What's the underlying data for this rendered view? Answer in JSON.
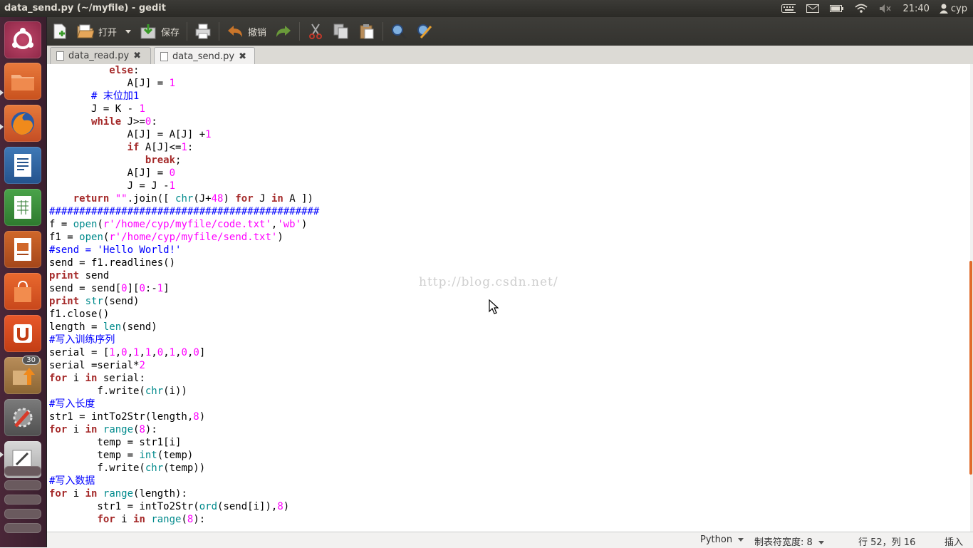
{
  "window": {
    "title": "data_send.py (~/myfile) - gedit"
  },
  "indicators": {
    "time": "21:40",
    "user": "cyp"
  },
  "launcher": {
    "badge_count": "30"
  },
  "toolbar": {
    "open_label": "打开",
    "save_label": "保存",
    "undo_label": "撤销"
  },
  "tabs": [
    {
      "label": "data_read.py"
    },
    {
      "label": "data_send.py"
    }
  ],
  "watermark": "http://blog.csdn.net/",
  "code_lines": [
    [
      [
        "          ",
        ""
      ],
      [
        "else",
        ":kw"
      ],
      [
        ":",
        ""
      ]
    ],
    [
      [
        "             A[J] = ",
        ""
      ],
      [
        "1",
        "num"
      ]
    ],
    [
      [
        "       ",
        ""
      ],
      [
        "# 末位加1",
        "cm"
      ]
    ],
    [
      [
        "       J = K - ",
        ""
      ],
      [
        "1",
        "num"
      ]
    ],
    [
      [
        "       ",
        ""
      ],
      [
        "while",
        "kw"
      ],
      [
        " J>=",
        ""
      ],
      [
        "0",
        "num"
      ],
      [
        ":",
        ""
      ]
    ],
    [
      [
        "             A[J] = A[J] +",
        ""
      ],
      [
        "1",
        "num"
      ]
    ],
    [
      [
        "             ",
        ""
      ],
      [
        "if",
        "kw"
      ],
      [
        " A[J]<=",
        ""
      ],
      [
        "1",
        "num"
      ],
      [
        ":",
        ""
      ]
    ],
    [
      [
        "                ",
        ""
      ],
      [
        "break",
        "kw"
      ],
      [
        ";",
        ""
      ]
    ],
    [
      [
        "             A[J] = ",
        ""
      ],
      [
        "0",
        "num"
      ]
    ],
    [
      [
        "             J = J -",
        ""
      ],
      [
        "1",
        "num"
      ]
    ],
    [
      [
        "    ",
        ""
      ],
      [
        "return",
        "kw"
      ],
      [
        " ",
        ""
      ],
      [
        "\"\"",
        "str"
      ],
      [
        ".join([ ",
        ""
      ],
      [
        "chr",
        "bi"
      ],
      [
        "(J+",
        ""
      ],
      [
        "48",
        "num"
      ],
      [
        ") ",
        ""
      ],
      [
        "for",
        "kw"
      ],
      [
        " J ",
        ""
      ],
      [
        "in",
        "kw"
      ],
      [
        " A ])",
        ""
      ]
    ],
    [
      [
        "#############################################",
        "cm"
      ]
    ],
    [
      [
        "f = ",
        ""
      ],
      [
        "open",
        "bi"
      ],
      [
        "(",
        ""
      ],
      [
        "r'/home/cyp/myfile/code.txt'",
        "str"
      ],
      [
        ",",
        ""
      ],
      [
        "'wb'",
        "str"
      ],
      [
        ")",
        ""
      ]
    ],
    [
      [
        "f1 = ",
        ""
      ],
      [
        "open",
        "bi"
      ],
      [
        "(",
        ""
      ],
      [
        "r'/home/cyp/myfile/send.txt'",
        "str"
      ],
      [
        ")",
        ""
      ]
    ],
    [
      [
        "#send = 'Hello World!'",
        "cm"
      ]
    ],
    [
      [
        "send = f1.readlines()",
        ""
      ]
    ],
    [
      [
        "print",
        "kw"
      ],
      [
        " send",
        ""
      ]
    ],
    [
      [
        "send = send[",
        ""
      ],
      [
        "0",
        "num"
      ],
      [
        "][",
        ""
      ],
      [
        "0",
        "num"
      ],
      [
        ":-",
        ""
      ],
      [
        "1",
        "num"
      ],
      [
        "]",
        ""
      ]
    ],
    [
      [
        "print",
        "kw"
      ],
      [
        " ",
        ""
      ],
      [
        "str",
        "bi"
      ],
      [
        "(send)",
        ""
      ]
    ],
    [
      [
        "f1.close()",
        ""
      ]
    ],
    [
      [
        "length = ",
        ""
      ],
      [
        "len",
        "bi"
      ],
      [
        "(send)",
        ""
      ]
    ],
    [
      [
        "#写入训练序列",
        "cm"
      ]
    ],
    [
      [
        "serial = [",
        ""
      ],
      [
        "1",
        "num"
      ],
      [
        ",",
        ""
      ],
      [
        "0",
        "num"
      ],
      [
        ",",
        ""
      ],
      [
        "1",
        "num"
      ],
      [
        ",",
        ""
      ],
      [
        "1",
        "num"
      ],
      [
        ",",
        ""
      ],
      [
        "0",
        "num"
      ],
      [
        ",",
        ""
      ],
      [
        "1",
        "num"
      ],
      [
        ",",
        ""
      ],
      [
        "0",
        "num"
      ],
      [
        ",",
        ""
      ],
      [
        "0",
        "num"
      ],
      [
        "]",
        ""
      ]
    ],
    [
      [
        "serial =serial*",
        ""
      ],
      [
        "2",
        "num"
      ]
    ],
    [
      [
        "for",
        "kw"
      ],
      [
        " i ",
        ""
      ],
      [
        "in",
        "kw"
      ],
      [
        " serial:",
        ""
      ]
    ],
    [
      [
        "        f.write(",
        ""
      ],
      [
        "chr",
        "bi"
      ],
      [
        "(i))",
        ""
      ]
    ],
    [
      [
        "#写入长度",
        "cm"
      ]
    ],
    [
      [
        "str1 = intTo2Str(length,",
        ""
      ],
      [
        "8",
        "num"
      ],
      [
        ")",
        ""
      ]
    ],
    [
      [
        "for",
        "kw"
      ],
      [
        " i ",
        ""
      ],
      [
        "in",
        "kw"
      ],
      [
        " ",
        ""
      ],
      [
        "range",
        "bi"
      ],
      [
        "(",
        ""
      ],
      [
        "8",
        "num"
      ],
      [
        "):",
        ""
      ]
    ],
    [
      [
        "        temp = str1[i]",
        ""
      ]
    ],
    [
      [
        "        temp = ",
        ""
      ],
      [
        "int",
        "bi"
      ],
      [
        "(temp)",
        ""
      ]
    ],
    [
      [
        "        f.write(",
        ""
      ],
      [
        "chr",
        "bi"
      ],
      [
        "(temp))",
        ""
      ]
    ],
    [
      [
        "#写入数据",
        "cm"
      ]
    ],
    [
      [
        "for",
        "kw"
      ],
      [
        " i ",
        ""
      ],
      [
        "in",
        "kw"
      ],
      [
        " ",
        ""
      ],
      [
        "range",
        "bi"
      ],
      [
        "(length):",
        ""
      ]
    ],
    [
      [
        "        str1 = intTo2Str(",
        ""
      ],
      [
        "ord",
        "bi"
      ],
      [
        "(send[i]),",
        ""
      ],
      [
        "8",
        "num"
      ],
      [
        ")",
        ""
      ]
    ],
    [
      [
        "        ",
        ""
      ],
      [
        "for",
        "kw"
      ],
      [
        " i ",
        ""
      ],
      [
        "in",
        "kw"
      ],
      [
        " ",
        ""
      ],
      [
        "range",
        "bi"
      ],
      [
        "(",
        ""
      ],
      [
        "8",
        "num"
      ],
      [
        "):",
        ""
      ]
    ]
  ],
  "statusbar": {
    "language": "Python",
    "tab_width": "制表符宽度: 8",
    "position": "行 52，列 16",
    "mode": "插入"
  }
}
